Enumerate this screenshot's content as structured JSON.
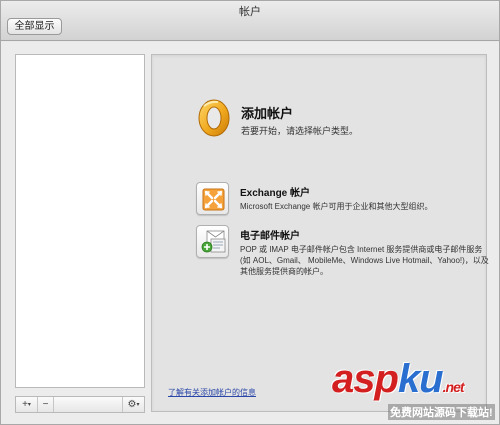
{
  "window": {
    "title": "帐户",
    "show_all_label": "全部显示"
  },
  "sidebar": {
    "toolbar": {
      "add_label": "+",
      "remove_label": "−",
      "caret": "▾",
      "gear_glyph": "⚙"
    }
  },
  "main": {
    "add_title": "添加帐户",
    "add_subtitle": "若要开始，请选择帐户类型。",
    "options": [
      {
        "title": "Exchange 帐户",
        "description": "Microsoft Exchange 帐户可用于企业和其他大型组织。",
        "icon": "exchange-icon"
      },
      {
        "title": "电子邮件帐户",
        "description": "POP 或 IMAP 电子邮件帐户包含 Internet 服务提供商或电子邮件服务(如 AOL、Gmail、 MobileMe、Windows Live Hotmail、Yahoo!)，以及其他服务提供商的帐户。",
        "icon": "email-account-icon"
      }
    ],
    "info_link": "了解有关添加帐户的信息"
  },
  "watermark": {
    "text_red": "asp",
    "text_blue": "ku",
    "text_small": ".net",
    "subtitle": "免费网站源码下载站!"
  },
  "colors": {
    "window_bg": "#ececec",
    "panel_bg": "#e3e3e3",
    "link": "#2a47a8",
    "outlook_orange": "#f0a81e",
    "exchange_orange": "#f5a23a"
  }
}
